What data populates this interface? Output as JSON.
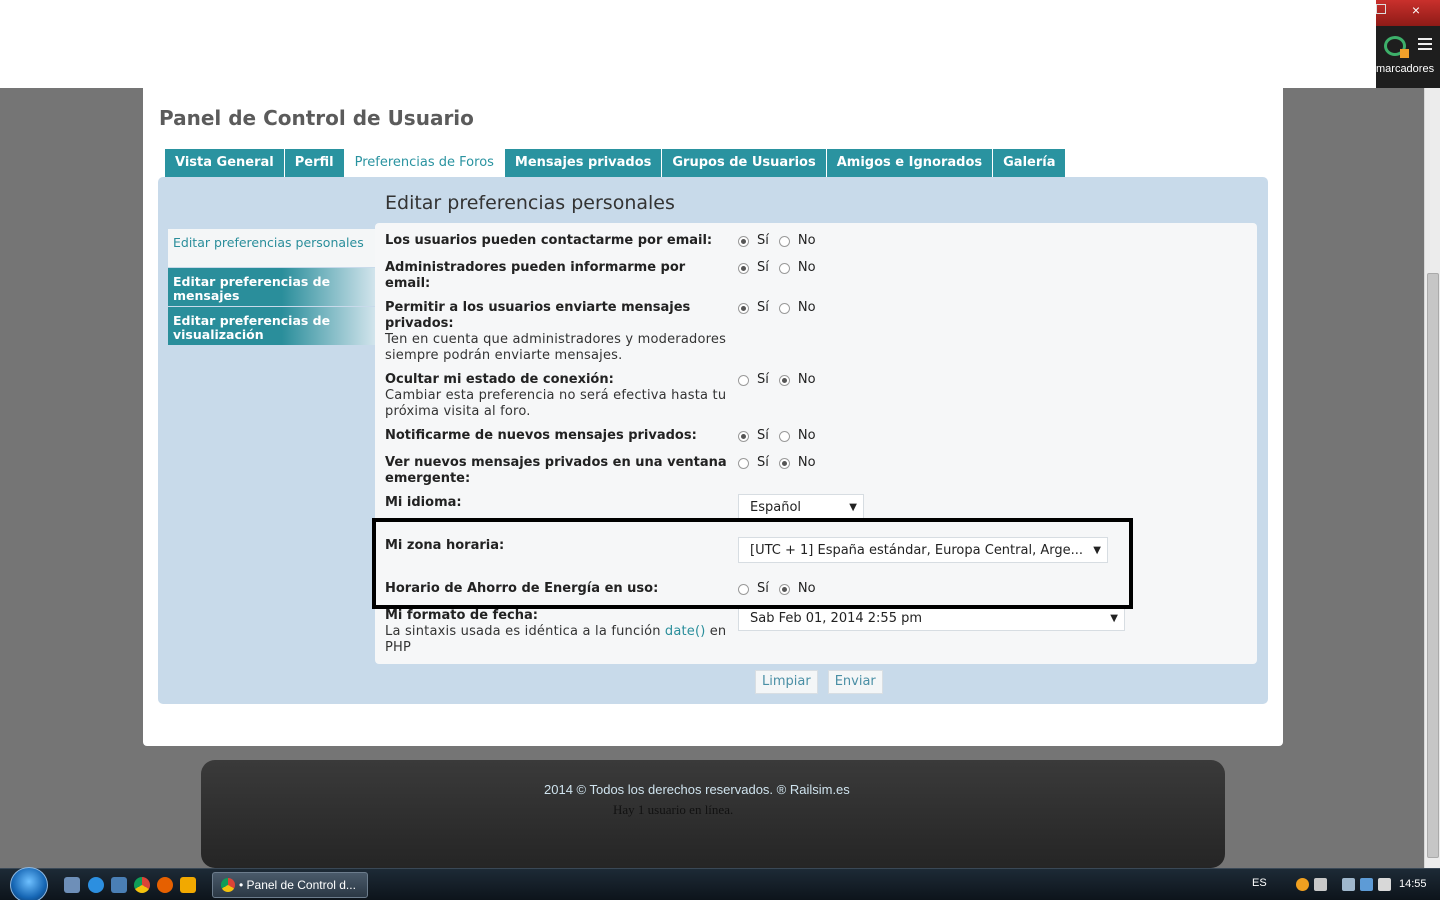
{
  "browser": {
    "bookmarks_label": "marcadores",
    "close_glyph": "×"
  },
  "page": {
    "title": "Panel de Control de Usuario",
    "tabs": [
      {
        "label": "Vista General",
        "active": false
      },
      {
        "label": "Perfil",
        "active": false
      },
      {
        "label": "Preferencias de Foros",
        "active": true
      },
      {
        "label": "Mensajes privados",
        "active": false
      },
      {
        "label": "Grupos de Usuarios",
        "active": false
      },
      {
        "label": "Amigos e Ignorados",
        "active": false
      },
      {
        "label": "Galería",
        "active": false
      }
    ],
    "sidenav": [
      {
        "label": "Editar preferencias personales",
        "active": true
      },
      {
        "label": "Editar preferencias de mensajes",
        "active": false
      },
      {
        "label": "Editar preferencias de visualización",
        "active": false
      }
    ],
    "section_title": "Editar preferencias personales",
    "yes_label": "Sí",
    "no_label": "No",
    "form": {
      "contact_email": {
        "label": "Los usuarios pueden contactarme por email:",
        "value": "Sí"
      },
      "admin_email": {
        "label": "Administradores pueden informarme por email:",
        "value": "Sí"
      },
      "allow_pm": {
        "label": "Permitir a los usuarios enviarte mensajes privados:",
        "explain": "Ten en cuenta que administradores y moderadores siempre podrán enviarte mensajes.",
        "value": "Sí"
      },
      "hide_online": {
        "label": "Ocultar mi estado de conexión:",
        "explain": "Cambiar esta preferencia no será efectiva hasta tu próxima visita al foro.",
        "value": "No"
      },
      "notify_pm": {
        "label": "Notificarme de nuevos mensajes privados:",
        "value": "Sí"
      },
      "popup_pm": {
        "label": "Ver nuevos mensajes privados en una ventana emergente:",
        "value": "No"
      },
      "language": {
        "label": "Mi idioma:",
        "value": "Español"
      },
      "timezone": {
        "label": "Mi zona horaria:",
        "value": "[UTC + 1] España estándar, Europa Central, Arge..."
      },
      "dst": {
        "label": "Horario de Ahorro de Energía en uso:",
        "value": "No"
      },
      "date_format": {
        "label": "Mi formato de fecha:",
        "explain_before": "La sintaxis usada es idéntica a la función",
        "explain_link": "date()",
        "explain_after": "en PHP",
        "value": "Sab Feb 01, 2014 2:55 pm"
      }
    },
    "buttons": {
      "reset": "Limpiar",
      "submit": "Enviar"
    }
  },
  "footer": {
    "copyright": "2014 © Todos los derechos reservados. ® Railsim.es",
    "online": "Hay 1 usuario en línea."
  },
  "taskbar": {
    "window_title": "• Panel de Control d...",
    "language": "ES",
    "clock": "14:55"
  }
}
